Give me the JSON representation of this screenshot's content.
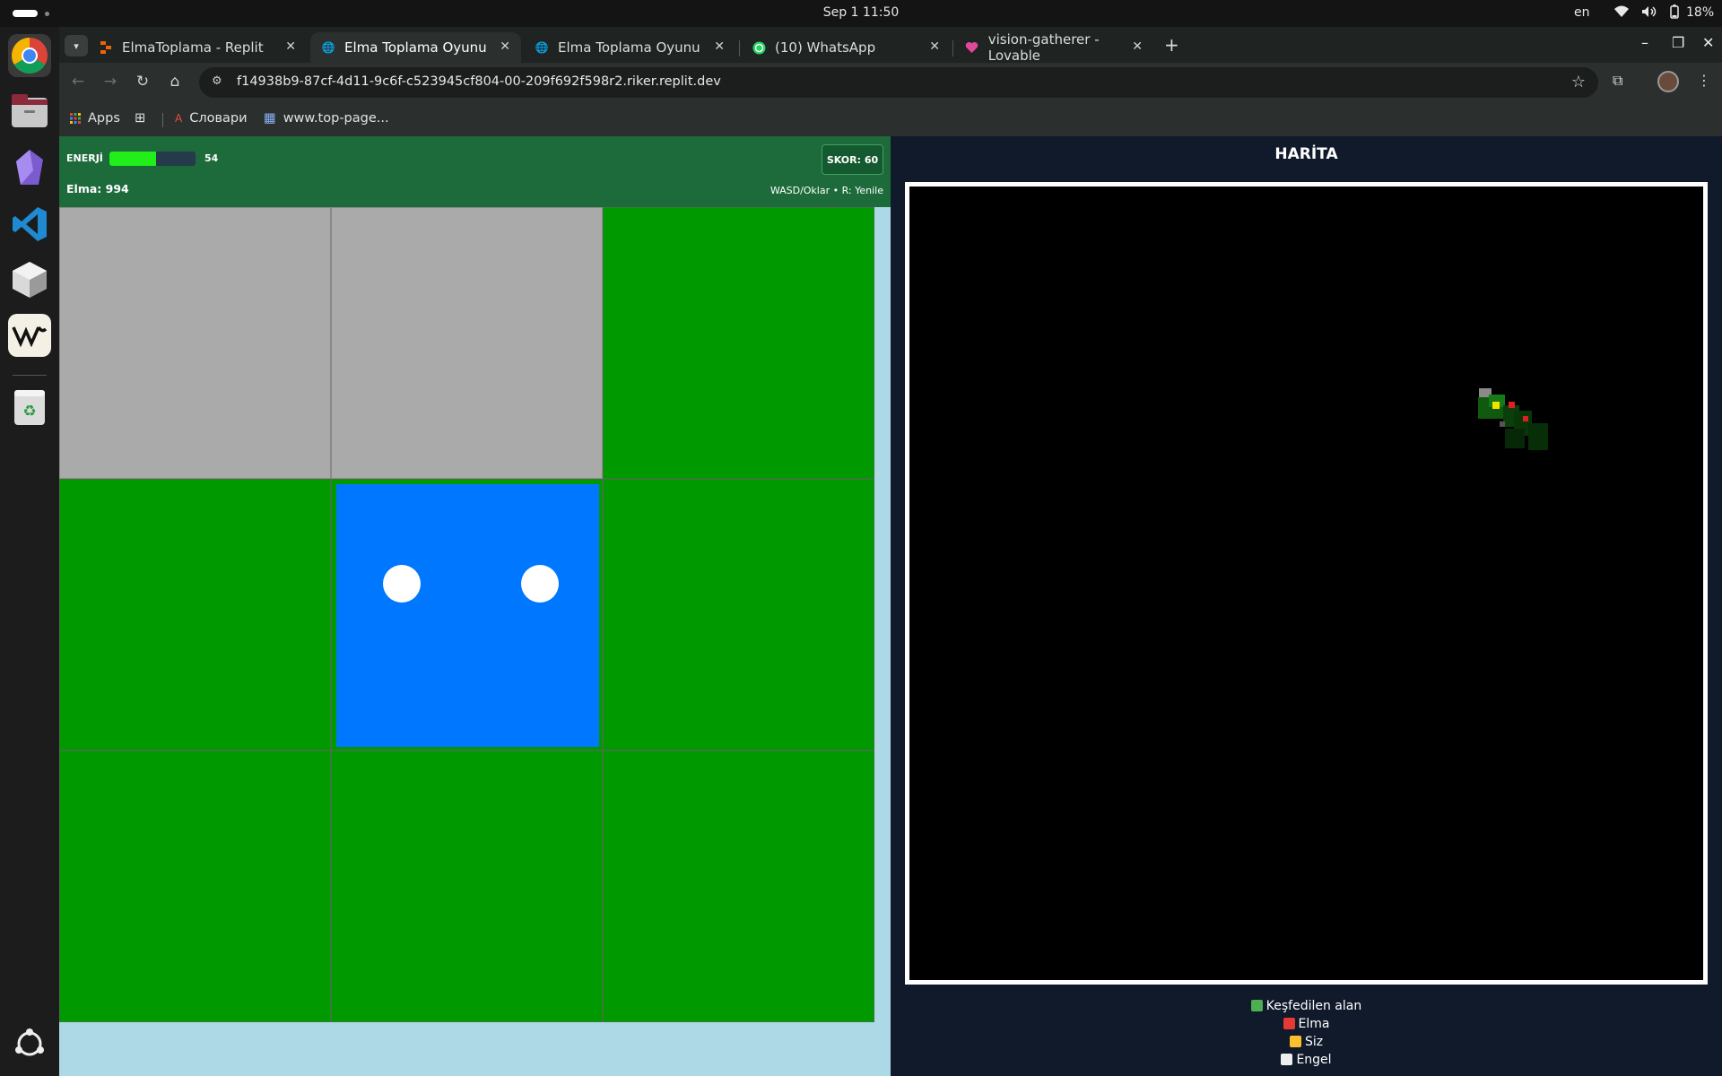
{
  "system": {
    "clock": "Sep 1  11:50",
    "language": "en",
    "battery": "18%"
  },
  "dock": {
    "apps": [
      "chrome-icon",
      "files-icon",
      "obsidian-icon",
      "vscode-icon",
      "box-app-icon",
      "w-app-icon",
      "trash-icon",
      "ubuntu-apps-icon"
    ]
  },
  "browser": {
    "tabs": [
      {
        "title": "ElmaToplama - Replit",
        "active": false
      },
      {
        "title": "Elma Toplama Oyunu",
        "active": true
      },
      {
        "title": "Elma Toplama Oyunu",
        "active": false
      },
      {
        "title": "(10) WhatsApp",
        "active": false
      },
      {
        "title": "vision-gatherer - Lovable",
        "active": false
      }
    ],
    "url": "f14938b9-87cf-4d11-9c6f-c523945cf804-00-209f692f598r2.riker.replit.dev",
    "bookmarks": [
      "Apps",
      "Словари",
      "www.top-page..."
    ]
  },
  "game": {
    "energy_label": "ENERJİ",
    "energy_value": "54",
    "energy_fraction": 0.54,
    "apple_count": "Elma: 994",
    "score": "SKOR: 60",
    "controls_hint": "WASD/Oklar • R: Yenile",
    "grid": [
      [
        "obstacle",
        "obstacle",
        "grass"
      ],
      [
        "grass",
        "player",
        "grass"
      ],
      [
        "grass",
        "grass",
        "grass"
      ]
    ]
  },
  "map": {
    "title": "HARİTA",
    "legend": [
      {
        "label": "Keşfedilen alan",
        "color": "#4caf50"
      },
      {
        "label": "Elma",
        "color": "#e53935"
      },
      {
        "label": "Siz",
        "color": "#fbc02d"
      },
      {
        "label": "Engel",
        "color": "#eeeeee"
      }
    ]
  }
}
